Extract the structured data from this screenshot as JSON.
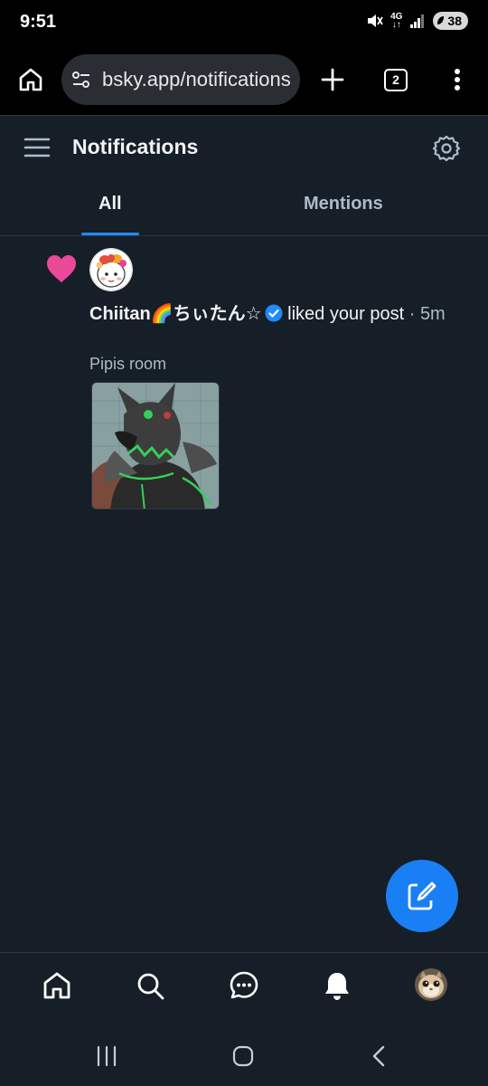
{
  "status_bar": {
    "time": "9:51",
    "network_top": "4G",
    "network_bottom": "↓↑",
    "battery": "38"
  },
  "browser": {
    "url": "bsky.app/notifications",
    "tab_count": "2"
  },
  "header": {
    "title": "Notifications"
  },
  "tabs": [
    {
      "label": "All",
      "active": true
    },
    {
      "label": "Mentions",
      "active": false
    }
  ],
  "notification": {
    "author": "Chiitan🌈ちぃたん☆",
    "action": "liked your post",
    "separator": "·",
    "time": "5m",
    "post_text": "Pipis room",
    "icon": "heart-icon"
  },
  "icons": {
    "home": "home-icon",
    "search": "search-icon",
    "chat": "chat-icon",
    "notifications": "bell-icon",
    "compose": "compose-icon"
  },
  "colors": {
    "background": "#161e27",
    "accent": "#208bfe",
    "like": "#ec4899",
    "fab": "#1a7ff4",
    "secondary_text": "#aebbc9"
  }
}
